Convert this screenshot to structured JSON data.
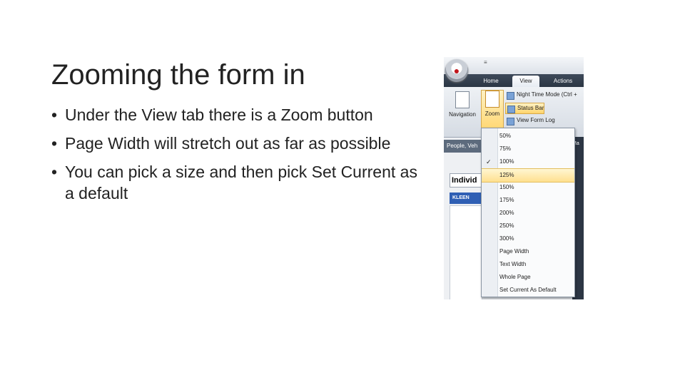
{
  "slide": {
    "title": "Zooming the form in",
    "bullets": [
      "Under the View tab there is a Zoom button",
      "Page Width will stretch out as far as possible",
      "You can pick a size and then pick Set Current as a default"
    ]
  },
  "screenshot": {
    "qat_glyph": "≡",
    "tabs": [
      "Home",
      "View",
      "Actions"
    ],
    "active_tab": "View",
    "ribbon": {
      "navigation_label": "Navigation",
      "zoom_label": "Zoom",
      "items": [
        "Night Time Mode (Ctrl +",
        "Status Bar",
        "View Form Log"
      ]
    },
    "people_bar": "People, Veh",
    "individual_label": "Individ",
    "record_label": "KLEEN",
    "right_text": "Ma",
    "zoom_menu": {
      "checked": "100%",
      "highlighted": "125%",
      "options": [
        "50%",
        "75%",
        "100%",
        "125%",
        "150%",
        "175%",
        "200%",
        "250%",
        "300%",
        "Page Width",
        "Text Width",
        "Whole Page",
        "Set Current As Default"
      ]
    }
  },
  "colors": {
    "highlight": "#ffe08f",
    "tab_bar": "#2c3644",
    "record_blue": "#2f5fb4"
  }
}
